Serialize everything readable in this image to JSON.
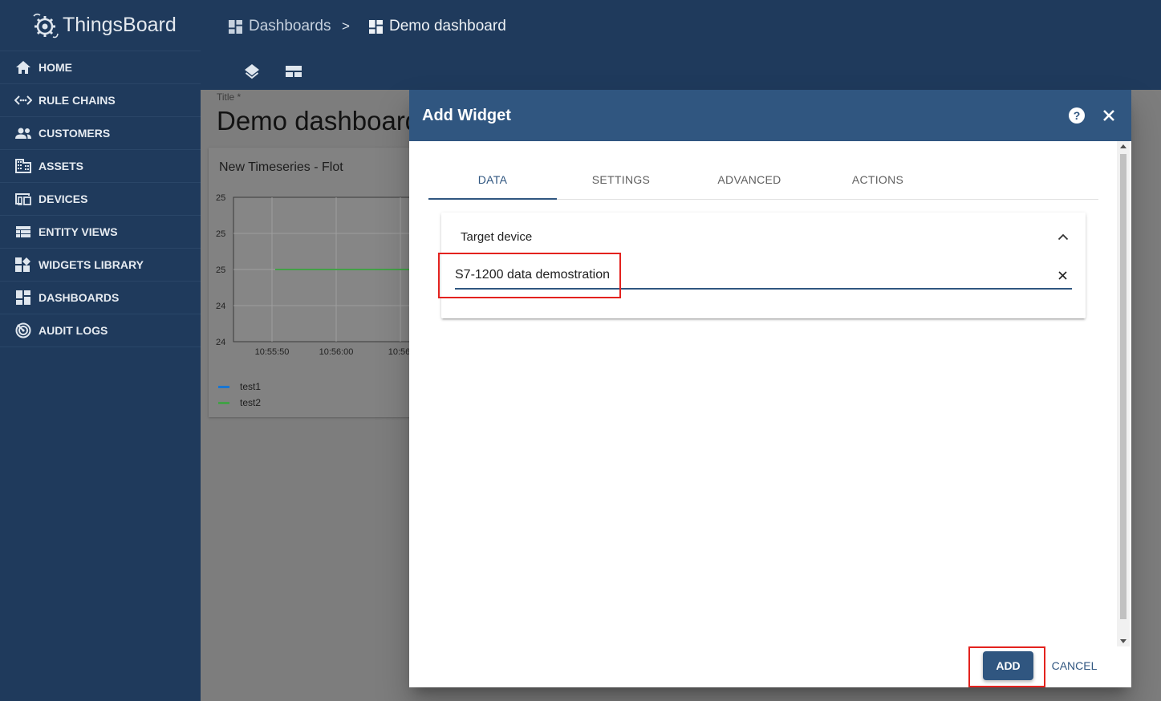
{
  "app": {
    "name": "ThingsBoard"
  },
  "sidebar": {
    "items": [
      {
        "label": "HOME",
        "icon": "home-icon"
      },
      {
        "label": "RULE CHAINS",
        "icon": "rule-chains-icon"
      },
      {
        "label": "CUSTOMERS",
        "icon": "customers-icon"
      },
      {
        "label": "ASSETS",
        "icon": "assets-icon"
      },
      {
        "label": "DEVICES",
        "icon": "devices-icon"
      },
      {
        "label": "ENTITY VIEWS",
        "icon": "entity-views-icon"
      },
      {
        "label": "WIDGETS LIBRARY",
        "icon": "widgets-library-icon"
      },
      {
        "label": "DASHBOARDS",
        "icon": "dashboards-icon"
      },
      {
        "label": "AUDIT LOGS",
        "icon": "audit-logs-icon"
      }
    ]
  },
  "header": {
    "breadcrumb": [
      "Dashboards",
      ">",
      "Demo dashboard"
    ]
  },
  "dashboard": {
    "title_label": "Title *",
    "title": "Demo dashboard",
    "widget": {
      "title": "New Timeseries - Flot",
      "legend": [
        {
          "name": "test1",
          "color": "#1976d2"
        },
        {
          "name": "test2",
          "color": "#43a047"
        }
      ]
    }
  },
  "chart_data": {
    "type": "line",
    "title": "New Timeseries - Flot",
    "y_tick_labels": [
      "25",
      "25",
      "25",
      "24",
      "24"
    ],
    "x_tick_labels": [
      "10:55:50",
      "10:56:00",
      "10:56:"
    ],
    "series": [
      {
        "name": "test2",
        "color": "#43a047",
        "x_start_tick": "10:55:50",
        "level_tick_index": 2
      }
    ],
    "grid": true
  },
  "dialog": {
    "title": "Add Widget",
    "tabs": [
      "DATA",
      "SETTINGS",
      "ADVANCED",
      "ACTIONS"
    ],
    "active_tab": "DATA",
    "target_device": {
      "label": "Target device",
      "value": "S7-1200 data demostration"
    },
    "buttons": {
      "add": "ADD",
      "cancel": "CANCEL"
    }
  },
  "colors": {
    "primary": "#305680",
    "sidebar": "#1f3a5c",
    "highlight": "#e3221e"
  }
}
